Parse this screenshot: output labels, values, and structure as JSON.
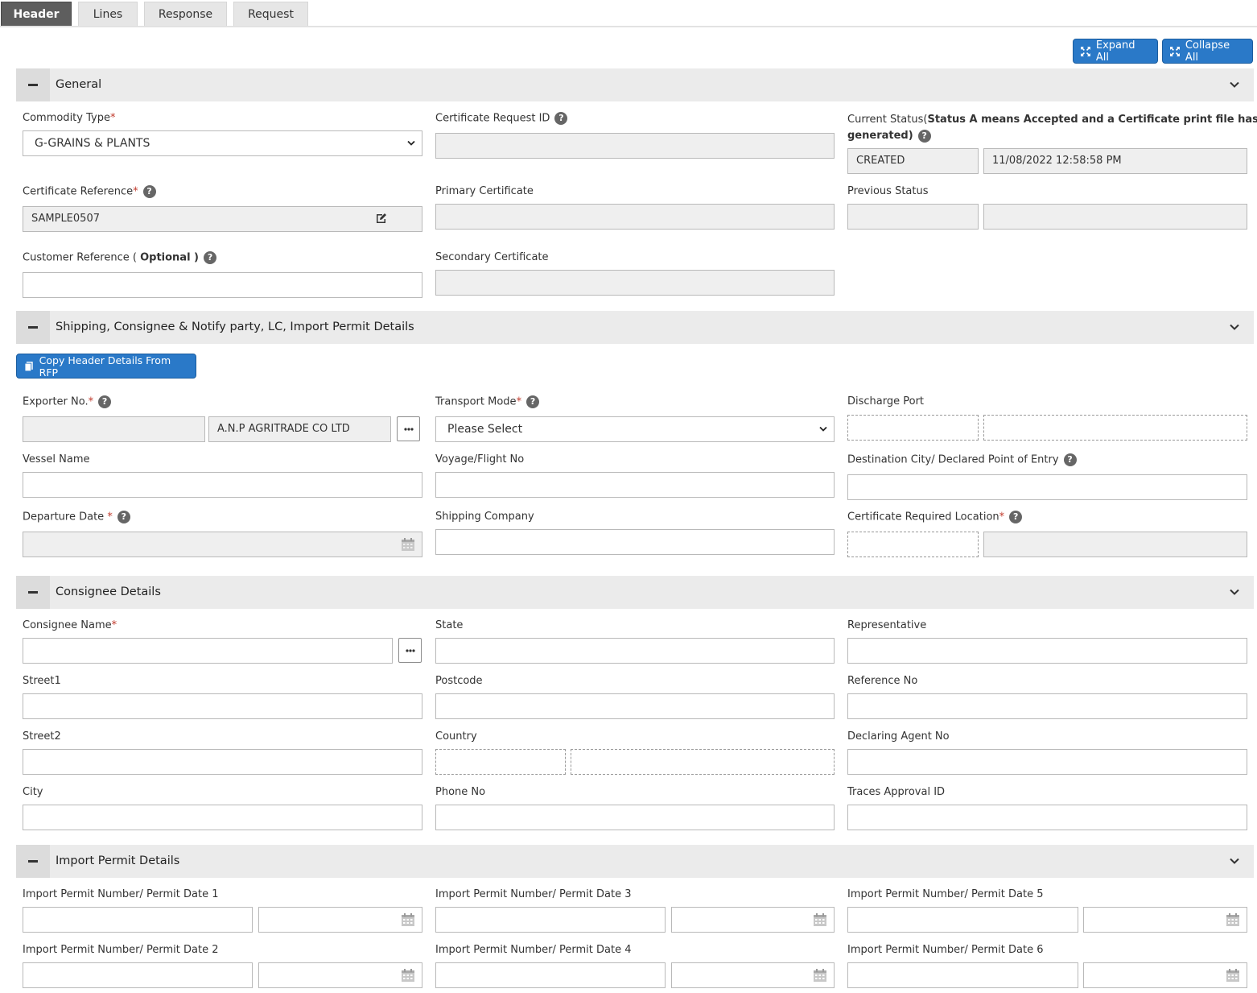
{
  "tabs": [
    "Header",
    "Lines",
    "Response",
    "Request"
  ],
  "toolbar": {
    "expand_all": "Expand All",
    "collapse_all": "Collapse All"
  },
  "sections": {
    "general": "General",
    "shipping": "Shipping, Consignee & Notify party, LC, Import Permit Details",
    "consignee": "Consignee Details",
    "import_permit": "Import Permit Details"
  },
  "general": {
    "commodity_type_label": "Commodity Type",
    "commodity_type_value": "G-GRAINS & PLANTS",
    "cert_request_id_label": "Certificate Request ID",
    "current_status_label_a": "Current Status(",
    "current_status_label_b": "Status A means Accepted and a Certificate print file has been",
    "current_status_label_c": "generated)",
    "current_status_value": "CREATED",
    "current_status_date": "11/08/2022 12:58:58 PM",
    "cert_reference_label": "Certificate Reference",
    "cert_reference_value": "SAMPLE0507",
    "primary_cert_label": "Primary Certificate",
    "previous_status_label": "Previous Status",
    "customer_ref_label": "Customer Reference ( ",
    "customer_ref_optional": "Optional )",
    "secondary_cert_label": "Secondary Certificate"
  },
  "shipping": {
    "copy_button": "Copy Header Details From RFP",
    "exporter_label": "Exporter No.",
    "exporter_name": "A.N.P AGRITRADE CO LTD",
    "transport_label": "Transport Mode",
    "transport_value": "Please Select",
    "discharge_label": "Discharge Port",
    "vessel_label": "Vessel Name",
    "voyage_label": "Voyage/Flight No",
    "destination_label": "Destination City/ Declared Point of Entry",
    "departure_label": "Departure Date ",
    "shipping_company_label": "Shipping Company",
    "cert_location_label": "Certificate Required Location"
  },
  "consignee": {
    "name_label": "Consignee Name",
    "state_label": "State",
    "representative_label": "Representative",
    "street1_label": "Street1",
    "postcode_label": "Postcode",
    "reference_label": "Reference No",
    "street2_label": "Street2",
    "country_label": "Country",
    "declaring_agent_label": "Declaring Agent No",
    "city_label": "City",
    "phone_label": "Phone No",
    "traces_label": "Traces Approval ID"
  },
  "import_permit": {
    "p1": "Import Permit Number/ Permit Date 1",
    "p2": "Import Permit Number/ Permit Date 2",
    "p3": "Import Permit Number/ Permit Date 3",
    "p4": "Import Permit Number/ Permit Date 4",
    "p5": "Import Permit Number/ Permit Date 5",
    "p6": "Import Permit Number/ Permit Date 6"
  },
  "colors": {
    "accent": "#2a79c8",
    "required": "#c0392b",
    "section_bg": "#ebebeb",
    "active_tab": "#5e5e5e"
  },
  "icons": [
    "minus-icon",
    "chevron-down-icon",
    "help-icon",
    "calendar-icon",
    "edit-icon",
    "ellipsis-icon",
    "expand-icon",
    "collapse-icon",
    "copy-icon",
    "caret-down-icon"
  ]
}
